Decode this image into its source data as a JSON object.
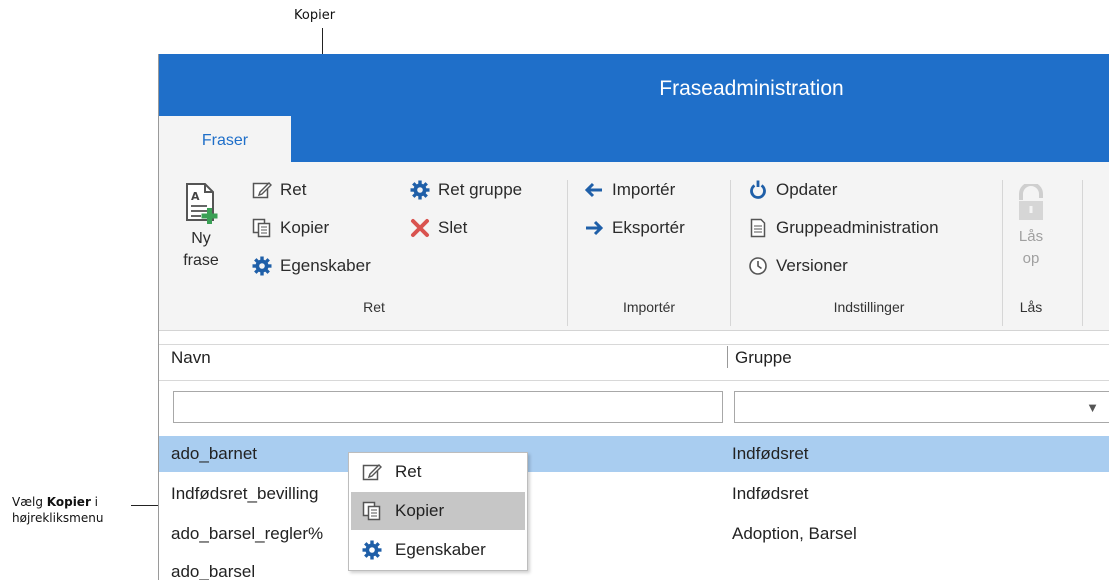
{
  "callouts": {
    "top": "Kopier",
    "left_prefix": "Vælg ",
    "left_bold": "Kopier",
    "left_suffix": " i",
    "left_line2": "højrekliksmenu"
  },
  "window": {
    "title": "Fraseadministration"
  },
  "tabs": [
    {
      "label": "Fraser",
      "active": true
    }
  ],
  "ribbon": {
    "ret": {
      "new_line1": "Ny",
      "new_line2": "frase",
      "ret": "Ret",
      "kopier": "Kopier",
      "egenskaber": "Egenskaber",
      "ret_gruppe": "Ret gruppe",
      "slet": "Slet",
      "label": "Ret"
    },
    "import": {
      "importer": "Importér",
      "eksporter": "Eksportér",
      "label": "Importér"
    },
    "settings": {
      "opdater": "Opdater",
      "gruppeadmin": "Gruppeadministration",
      "versioner": "Versioner",
      "label": "Indstillinger"
    },
    "lock": {
      "line1": "Lås",
      "line2": "op",
      "label": "Lås"
    }
  },
  "grid": {
    "columns": [
      "Navn",
      "Gruppe"
    ],
    "filters": {
      "name_value": "",
      "group_value": ""
    },
    "rows": [
      {
        "name": "ado_barnet",
        "group": "Indfødsret",
        "selected": true
      },
      {
        "name": "Indfødsret_bevilling",
        "group": "Indfødsret",
        "selected": false
      },
      {
        "name": "ado_barsel_regler%",
        "group": "Adoption, Barsel",
        "selected": false
      },
      {
        "name": "ado_barsel",
        "group": "",
        "selected": false
      }
    ]
  },
  "context_menu": {
    "items": [
      {
        "label": "Ret",
        "icon": "edit-icon"
      },
      {
        "label": "Kopier",
        "icon": "copy-icon",
        "highlighted": true
      },
      {
        "label": "Egenskaber",
        "icon": "gear-icon"
      }
    ]
  },
  "colors": {
    "accent": "#1f6fc9",
    "selection": "#a9cdf0",
    "delete": "#d9534f",
    "menu_highlight": "#c6c6c6"
  }
}
